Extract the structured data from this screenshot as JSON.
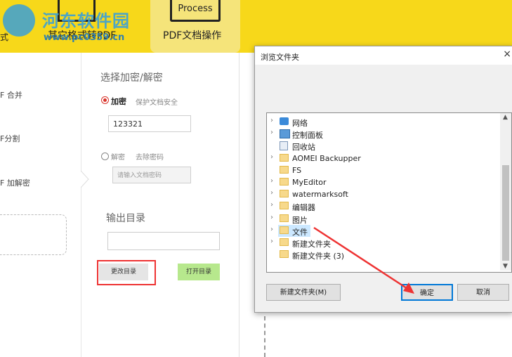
{
  "watermark": {
    "brand": "河东软件园",
    "url": "www.pc0359.cn"
  },
  "topbar": {
    "left_partial": "式",
    "tab_other": "其它格式转PDF",
    "tab_active_icon": "Process",
    "tab_active": "PDF文档操作"
  },
  "nav": {
    "items": [
      "F 合并",
      "F分割",
      "F 加解密"
    ]
  },
  "panel": {
    "section_title": "选择加密/解密",
    "encrypt_label": "加密",
    "encrypt_hint": "保护文档安全",
    "password_value": "123321",
    "decrypt_label": "解密",
    "decrypt_hint": "去除密码",
    "decrypt_placeholder": "请输入文档密码",
    "output_title": "输出目录",
    "output_value": "",
    "change_dir": "更改目录",
    "open_dir": "打开目录"
  },
  "dialog": {
    "title": "浏览文件夹",
    "close": "×",
    "tree": [
      {
        "label": "网络",
        "icon": "network-icon",
        "expand": true
      },
      {
        "label": "控制面板",
        "icon": "control-panel-icon",
        "expand": true
      },
      {
        "label": "回收站",
        "icon": "recycle-bin-icon",
        "expand": false
      },
      {
        "label": "AOMEI Backupper",
        "icon": "folder-icon",
        "expand": true
      },
      {
        "label": "FS",
        "icon": "folder-icon",
        "expand": false
      },
      {
        "label": "MyEditor",
        "icon": "folder-icon",
        "expand": true
      },
      {
        "label": "watermarksoft",
        "icon": "folder-icon",
        "expand": true
      },
      {
        "label": "编辑器",
        "icon": "folder-icon",
        "expand": true
      },
      {
        "label": "图片",
        "icon": "folder-icon",
        "expand": true
      },
      {
        "label": "文件",
        "icon": "folder-icon",
        "expand": true,
        "selected": true
      },
      {
        "label": "新建文件夹",
        "icon": "folder-icon",
        "expand": true
      },
      {
        "label": "新建文件夹 (3)",
        "icon": "folder-icon",
        "expand": false
      }
    ],
    "new_folder": "新建文件夹(M)",
    "ok": "确定",
    "cancel": "取消"
  },
  "colors": {
    "topbar": "#f7d81a",
    "accent_red": "#e33333",
    "selection": "#cce8ff"
  }
}
